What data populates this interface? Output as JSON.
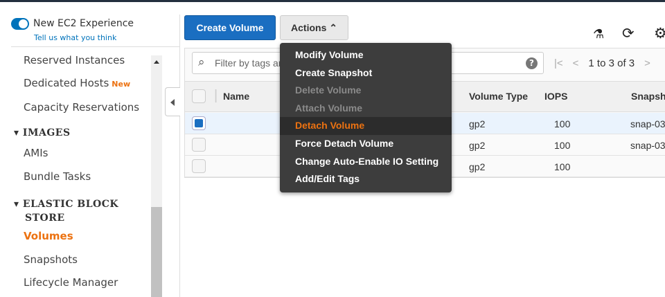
{
  "sidebar": {
    "experience_label": "New EC2 Experience",
    "feedback_link": "Tell us what you think",
    "items": [
      {
        "label": "Reserved Instances"
      },
      {
        "label": "Dedicated Hosts",
        "badge": "New"
      },
      {
        "label": "Capacity Reservations"
      }
    ],
    "images_header": "IMAGES",
    "images_items": [
      "AMIs",
      "Bundle Tasks"
    ],
    "ebs_header_line1": "ELASTIC BLOCK",
    "ebs_header_line2": "STORE",
    "ebs_items": [
      "Volumes",
      "Snapshots",
      "Lifecycle Manager"
    ]
  },
  "toolbar": {
    "create_label": "Create Volume",
    "actions_label": "Actions ⌃"
  },
  "filter": {
    "placeholder": "Filter by tags and attributes or search by keyword"
  },
  "pager": {
    "text": "1 to 3 of 3"
  },
  "table": {
    "headers": [
      "Name",
      "Volume Type",
      "IOPS",
      "Snapsh"
    ],
    "rows": [
      {
        "type": "gp2",
        "iops": "100",
        "snapshot": "snap-03",
        "selected": true
      },
      {
        "type": "gp2",
        "iops": "100",
        "snapshot": "snap-03",
        "selected": false
      },
      {
        "type": "gp2",
        "iops": "100",
        "snapshot": "",
        "selected": false
      }
    ]
  },
  "menu": {
    "items": [
      {
        "label": "Modify Volume"
      },
      {
        "label": "Create Snapshot"
      },
      {
        "label": "Delete Volume",
        "disabled": true
      },
      {
        "label": "Attach Volume",
        "disabled": true
      },
      {
        "label": "Detach Volume",
        "highlighted": true
      },
      {
        "label": "Force Detach Volume"
      },
      {
        "label": "Change Auto-Enable IO Setting"
      },
      {
        "label": "Add/Edit Tags"
      }
    ]
  }
}
